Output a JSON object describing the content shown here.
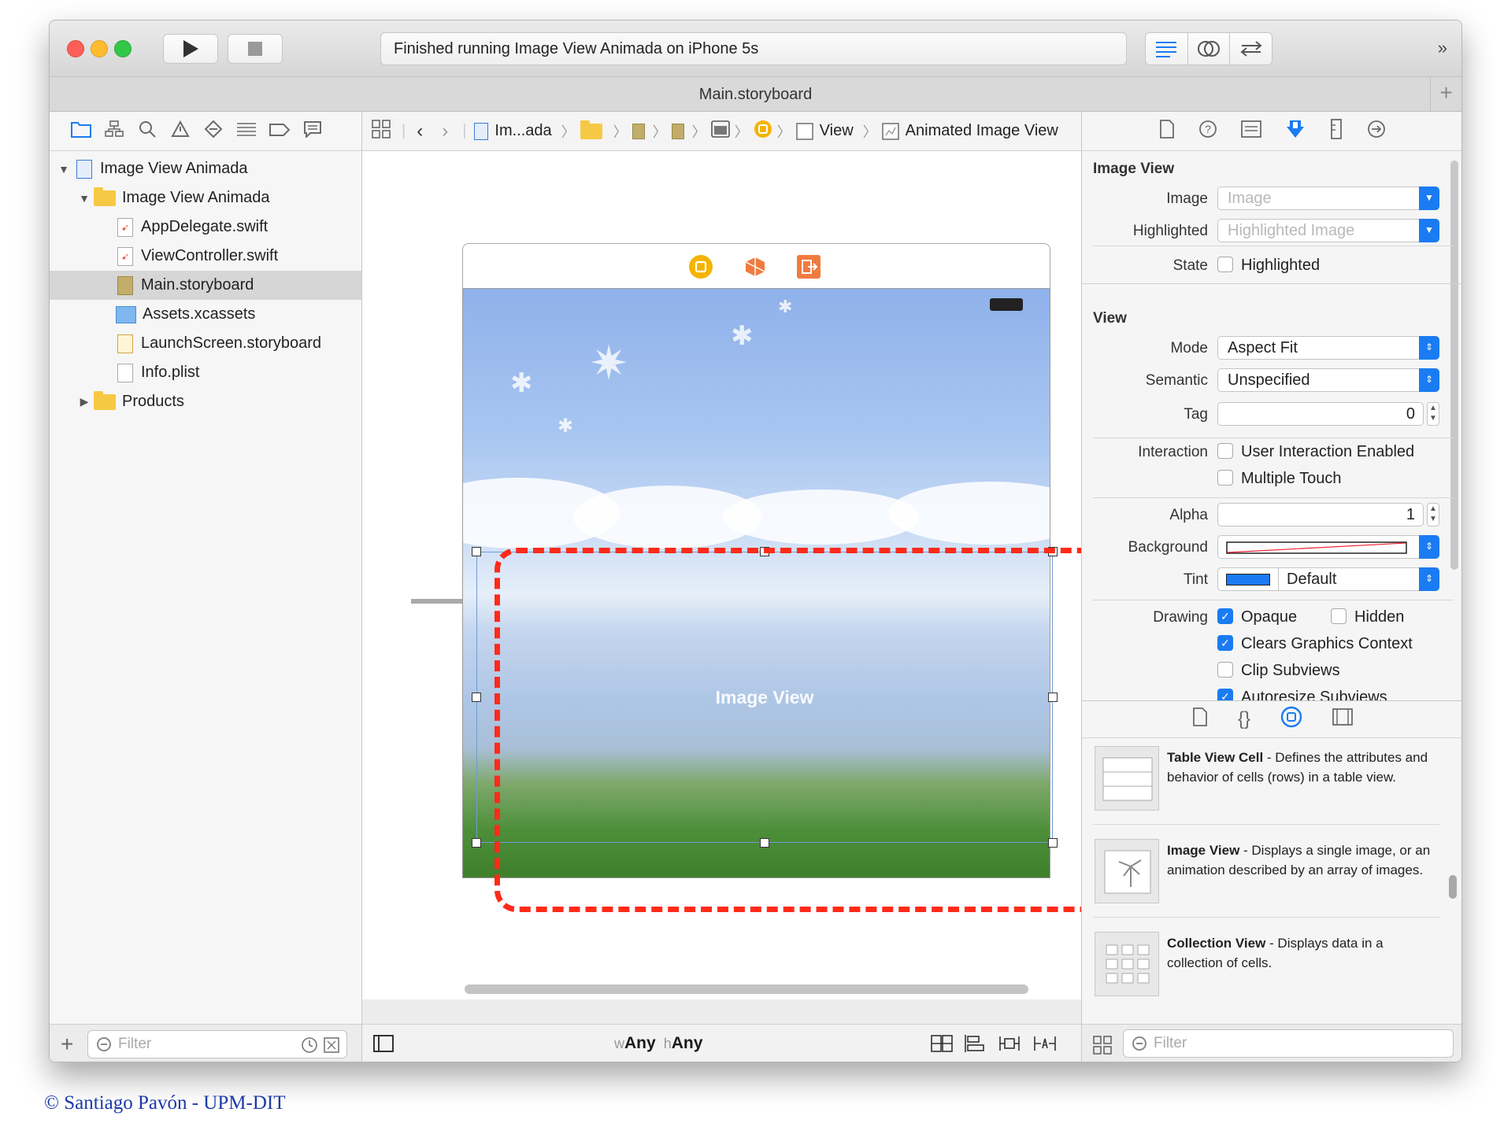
{
  "toolbar": {
    "status": "Finished running Image View Animada on iPhone 5s",
    "overflow_icon": "»"
  },
  "tab": {
    "title": "Main.storyboard",
    "add": "+"
  },
  "navigator": {
    "tree": [
      {
        "label": "Image View Animada",
        "icon": "project-icon"
      },
      {
        "label": "Image View Animada",
        "icon": "folder-icon"
      },
      {
        "label": "AppDelegate.swift",
        "icon": "swift-file-icon"
      },
      {
        "label": "ViewController.swift",
        "icon": "swift-file-icon"
      },
      {
        "label": "Main.storyboard",
        "icon": "storyboard-icon",
        "selected": true
      },
      {
        "label": "Assets.xcassets",
        "icon": "assets-icon"
      },
      {
        "label": "LaunchScreen.storyboard",
        "icon": "storyboard-icon"
      },
      {
        "label": "Info.plist",
        "icon": "plist-icon"
      },
      {
        "label": "Products",
        "icon": "folder-icon"
      }
    ],
    "filter_placeholder": "Filter"
  },
  "jumpbar": {
    "project": "Im...ada",
    "view": "View",
    "current": "Animated Image View"
  },
  "canvas": {
    "image_view_label": "Image View"
  },
  "editor_bottom": {
    "size_class_w_prefix": "w",
    "size_class_w": "Any",
    "size_class_h_prefix": "h",
    "size_class_h": "Any"
  },
  "inspector": {
    "image_view_section": "Image View",
    "image_label": "Image",
    "image_placeholder": "Image",
    "highlighted_label": "Highlighted",
    "highlighted_placeholder": "Highlighted Image",
    "state_label": "State",
    "state_highlighted": "Highlighted",
    "view_section": "View",
    "mode_label": "Mode",
    "mode_value": "Aspect Fit",
    "semantic_label": "Semantic",
    "semantic_value": "Unspecified",
    "tag_label": "Tag",
    "tag_value": "0",
    "interaction_label": "Interaction",
    "user_interaction": "User Interaction Enabled",
    "multiple_touch": "Multiple Touch",
    "alpha_label": "Alpha",
    "alpha_value": "1",
    "background_label": "Background",
    "tint_label": "Tint",
    "tint_value": "Default",
    "tint_color": "#1a7bf2",
    "drawing_label": "Drawing",
    "opaque": "Opaque",
    "hidden": "Hidden",
    "clears_graphics": "Clears Graphics Context",
    "clip_subviews": "Clip Subviews",
    "autoresize_subviews": "Autoresize Subviews"
  },
  "library": {
    "items": [
      {
        "title": "Table View Cell",
        "desc": " - Defines the attributes and behavior of cells (rows) in a table view."
      },
      {
        "title": "Image View",
        "desc": " - Displays a single image, or an animation described by an array of images."
      },
      {
        "title": "Collection View",
        "desc": " - Displays data in a collection of cells."
      }
    ],
    "filter_placeholder": "Filter"
  },
  "footer": {
    "copyright": "© Santiago Pavón - UPM-DIT"
  },
  "colors": {
    "accent": "#1a7bf2",
    "highlight_outline": "#ff2a1a"
  }
}
